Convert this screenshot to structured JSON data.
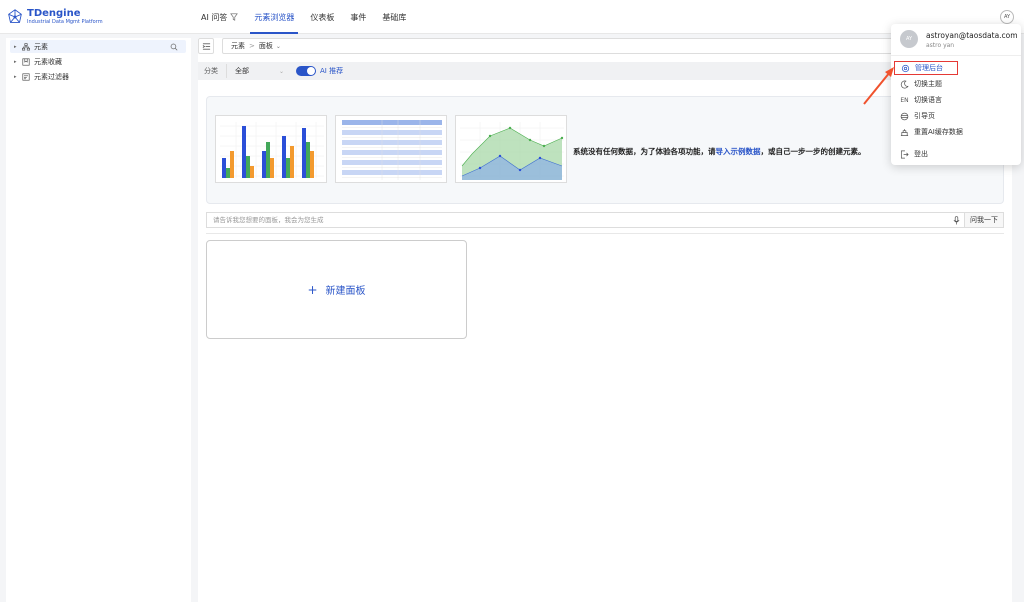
{
  "app": {
    "brand": "TDengine",
    "subtitle": "Industrial Data Mgmt Platform"
  },
  "nav": {
    "items": [
      {
        "label": "AI 问答"
      },
      {
        "label": "元素浏览器"
      },
      {
        "label": "仪表板"
      },
      {
        "label": "事件"
      },
      {
        "label": "基础库"
      }
    ],
    "active": "元素浏览器",
    "avatar_initials": "AY"
  },
  "sidebar": {
    "items": [
      {
        "label": "元素",
        "icon": "network-icon"
      },
      {
        "label": "元素收藏",
        "icon": "bookmark-icon"
      },
      {
        "label": "元素过滤器",
        "icon": "filter-list-icon"
      }
    ]
  },
  "breadcrumb": {
    "root": "元素",
    "separator": ">",
    "current": "面板"
  },
  "filter": {
    "label": "分类",
    "selected": "全部",
    "ai_toggle_label": "AI 推荐",
    "ai_toggle_on": true
  },
  "empty_state": {
    "message_before": "系统没有任何数据，为了体验各项功能，请",
    "link": "导入示例数据",
    "message_after": "，或自己一步一步的创建元素。"
  },
  "ask": {
    "placeholder": "请告诉我您想要的面板，我会为您生成",
    "button": "问我一下"
  },
  "new_panel": {
    "label": "新建面板"
  },
  "user_menu": {
    "avatar_initials": "AY",
    "email": "astroyan@taosdata.com",
    "name": "astro yan",
    "items": [
      {
        "label": "管理后台",
        "icon": "gear-icon",
        "highlighted": true
      },
      {
        "label": "切换主题",
        "icon": "moon-icon"
      },
      {
        "label": "切换语言",
        "icon": "EN"
      },
      {
        "label": "引导页",
        "icon": "guide-icon"
      },
      {
        "label": "重置AI缓存数据",
        "icon": "reset-icon"
      },
      {
        "label": "登出",
        "icon": "logout-icon"
      }
    ]
  },
  "colors": {
    "accent": "#2a55c8",
    "highlight_border": "#e53935",
    "annotation_arrow": "#f0522d"
  }
}
